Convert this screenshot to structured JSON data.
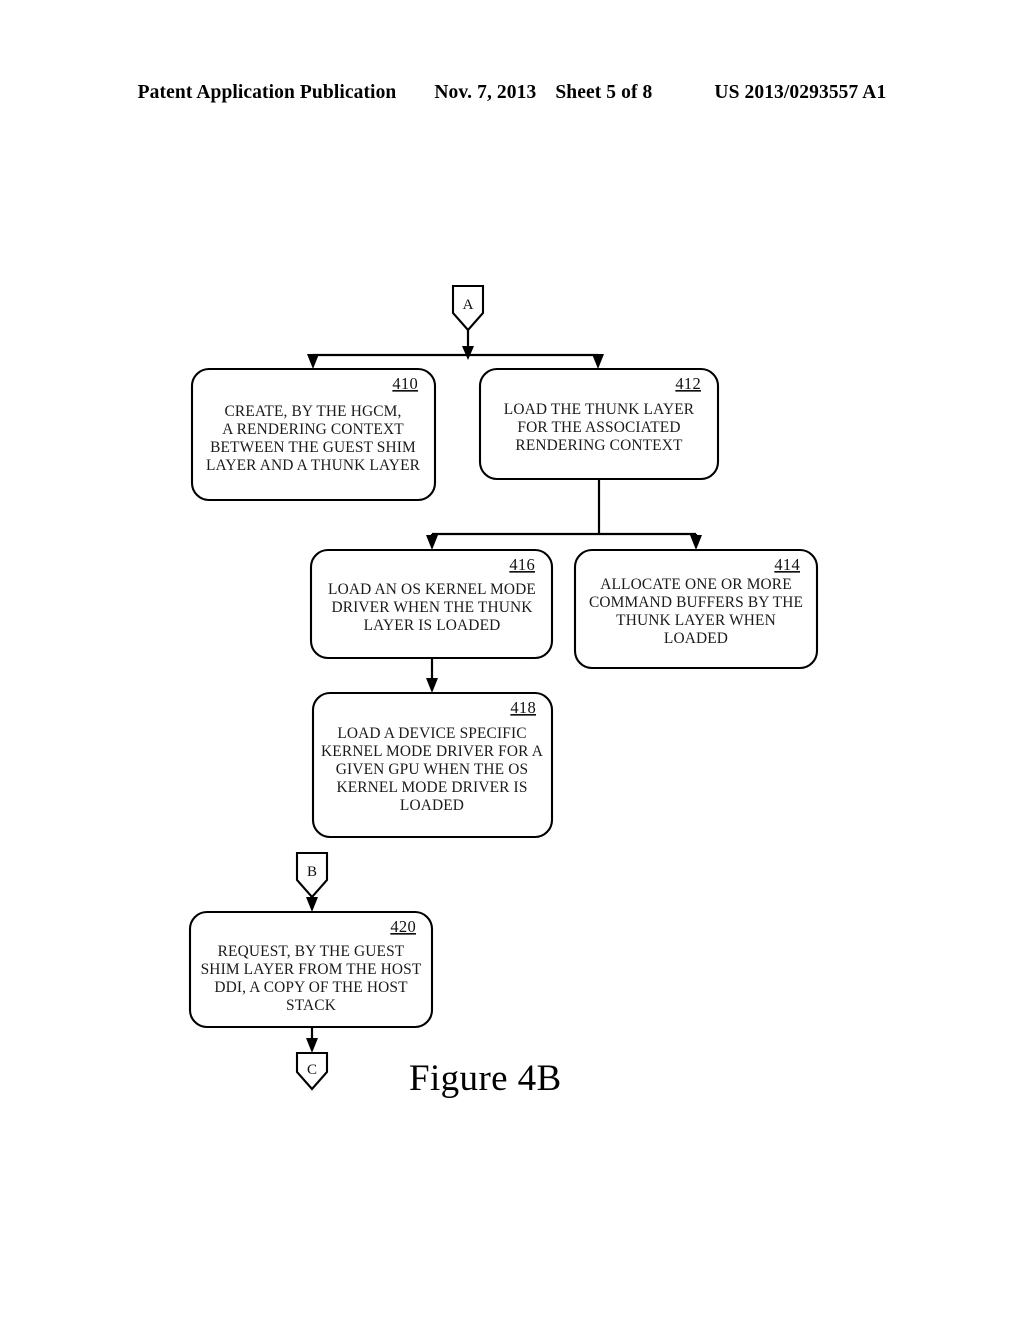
{
  "header": {
    "publication": "Patent Application Publication",
    "date": "Nov. 7, 2013",
    "sheet": "Sheet 5 of 8",
    "patent_number": "US 2013/0293557 A1"
  },
  "figure": {
    "caption": "Figure 4B",
    "stroke_color": "#000000",
    "background_color": "#ffffff"
  },
  "connectors": {
    "a": {
      "label": "A"
    },
    "b": {
      "label": "B"
    },
    "c": {
      "label": "C"
    }
  },
  "boxes": [
    {
      "id": "410",
      "number": "410",
      "lines": [
        "CREATE, BY THE HGCM,",
        "A RENDERING CONTEXT",
        "BETWEEN THE GUEST SHIM",
        "LAYER AND A THUNK LAYER"
      ]
    },
    {
      "id": "412",
      "number": "412",
      "lines": [
        "LOAD THE THUNK LAYER",
        "FOR THE ASSOCIATED",
        "RENDERING CONTEXT"
      ]
    },
    {
      "id": "416",
      "number": "416",
      "lines": [
        "LOAD AN OS KERNEL MODE",
        "DRIVER WHEN THE THUNK",
        "LAYER IS LOADED"
      ]
    },
    {
      "id": "414",
      "number": "414",
      "lines": [
        "ALLOCATE ONE OR MORE",
        "COMMAND BUFFERS BY THE",
        "THUNK LAYER WHEN",
        "LOADED"
      ]
    },
    {
      "id": "418",
      "number": "418",
      "lines": [
        "LOAD A DEVICE SPECIFIC",
        "KERNEL MODE DRIVER FOR A",
        "GIVEN GPU WHEN THE OS",
        "KERNEL MODE DRIVER IS",
        "LOADED"
      ]
    },
    {
      "id": "420",
      "number": "420",
      "lines": [
        "REQUEST, BY THE GUEST",
        "SHIM LAYER FROM THE HOST",
        "DDI, A COPY OF THE HOST",
        "STACK"
      ]
    }
  ]
}
